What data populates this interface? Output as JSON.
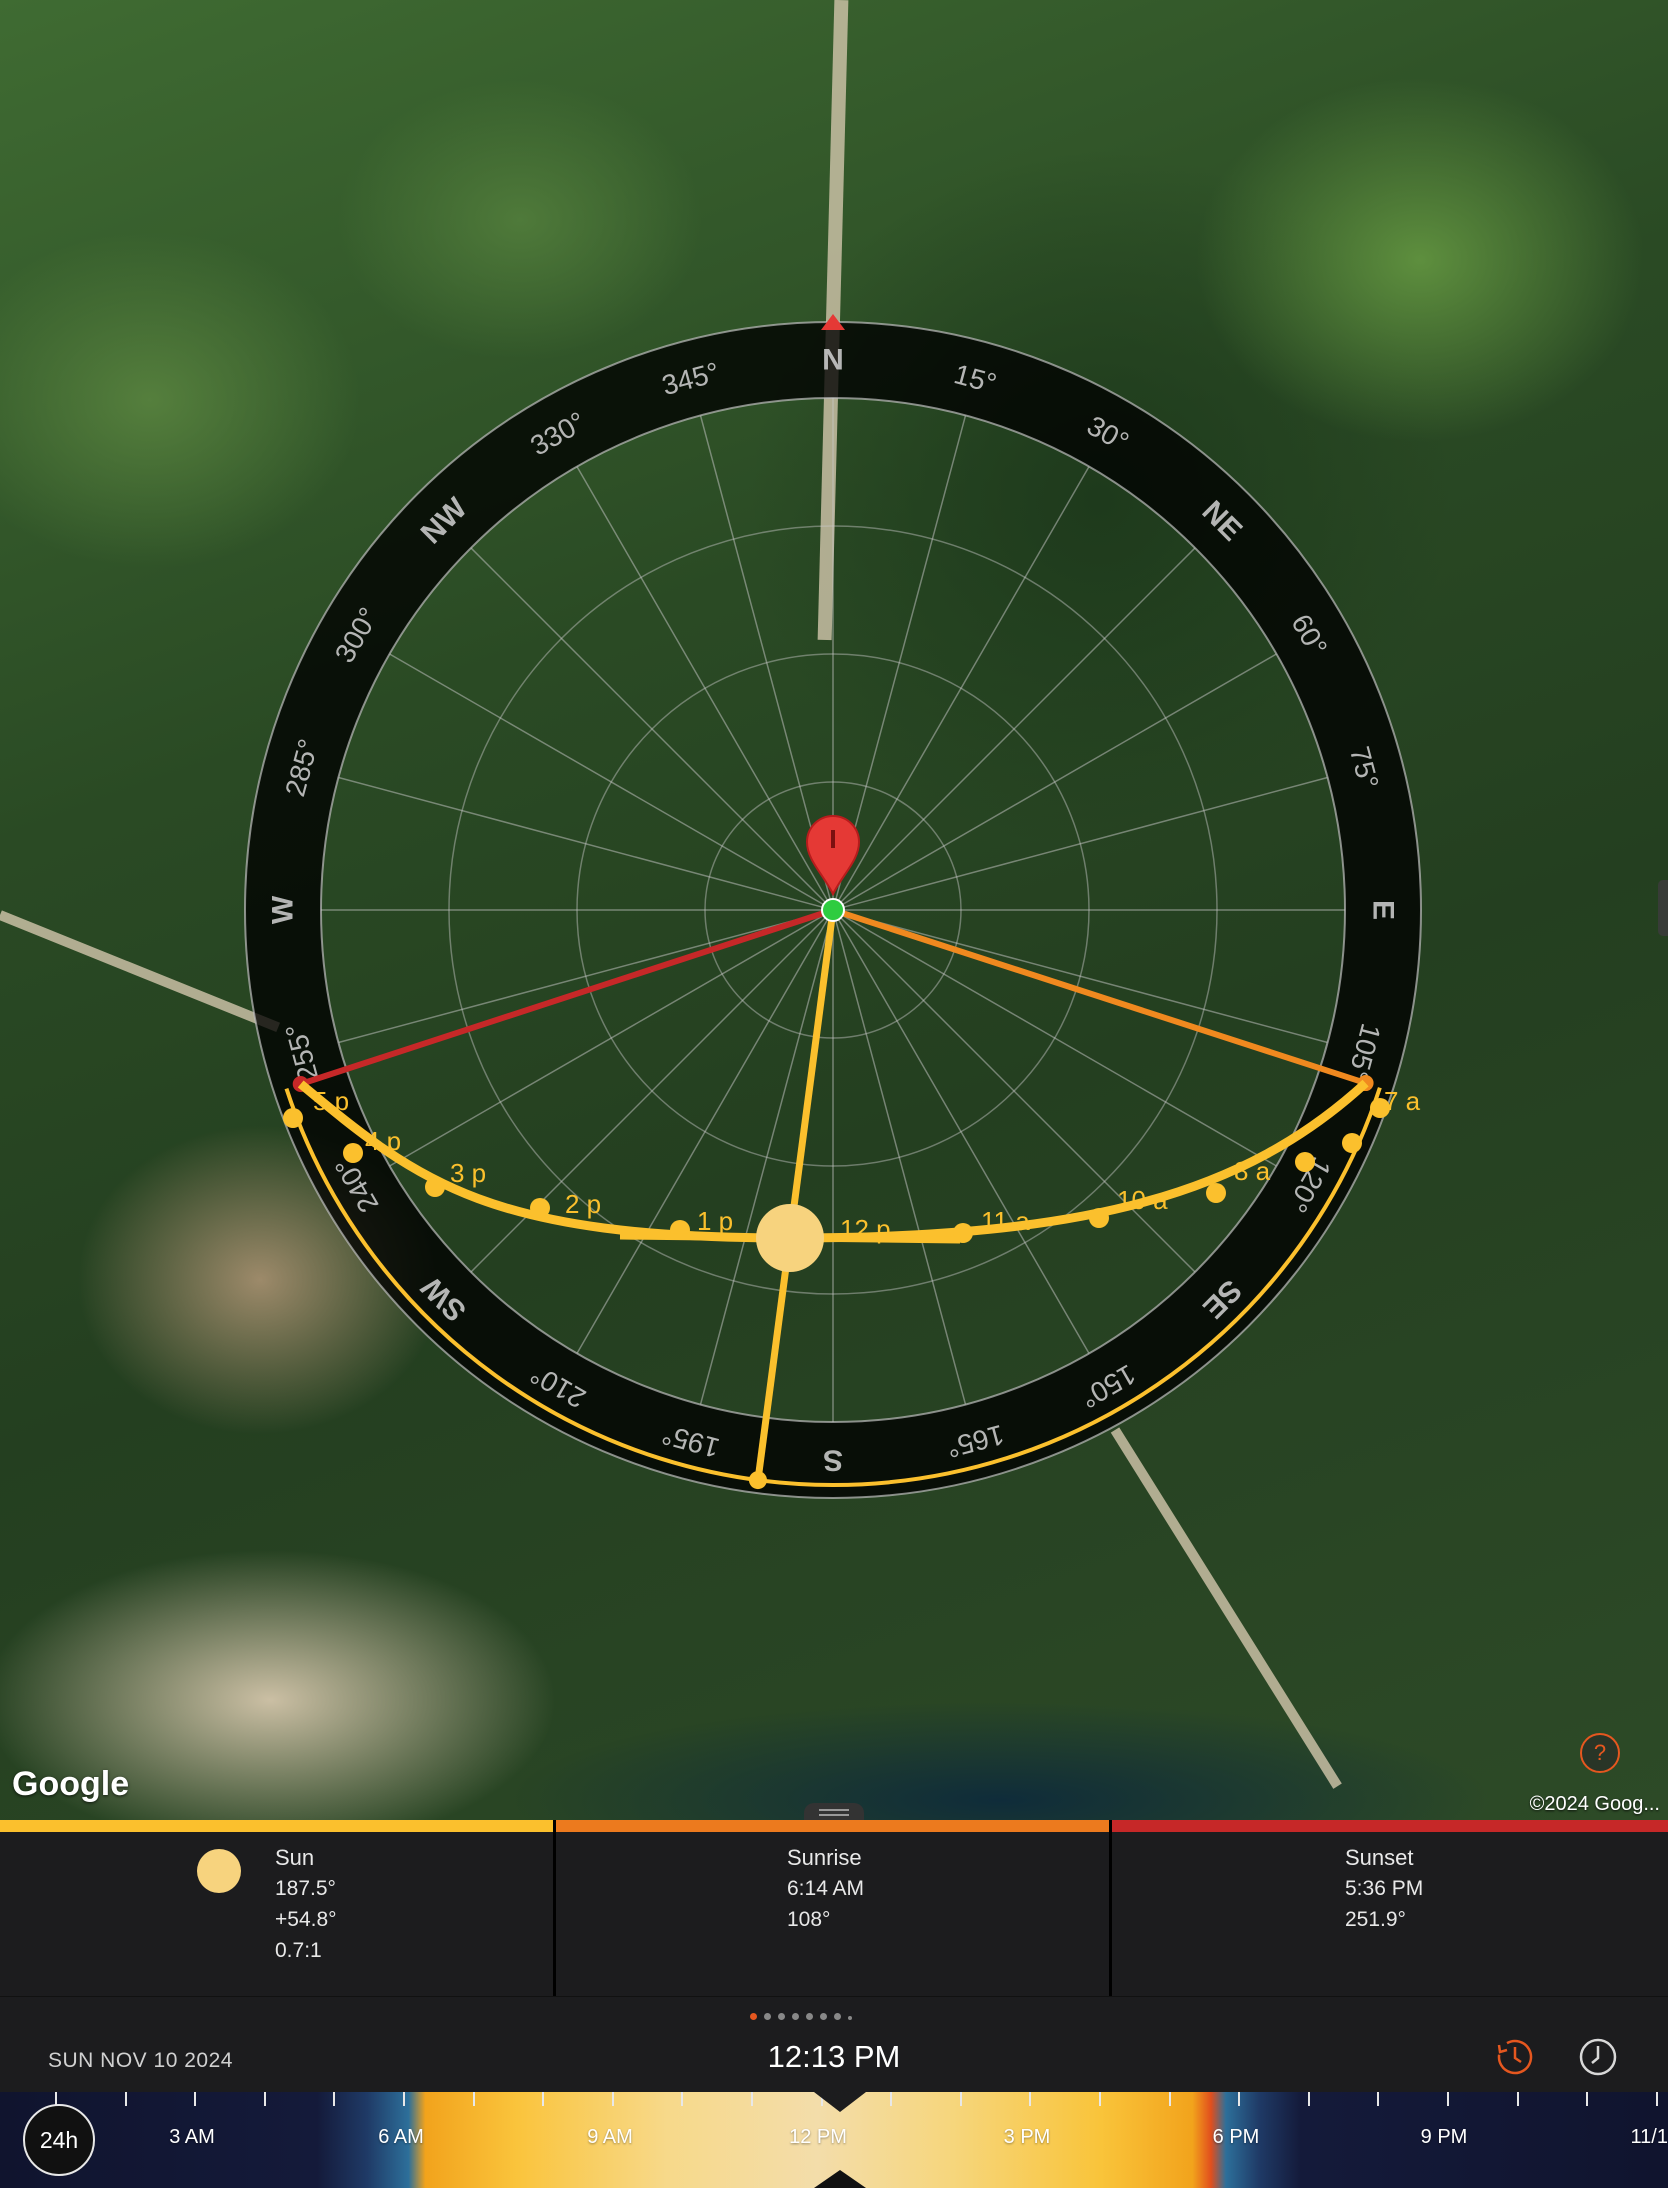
{
  "map": {
    "attribution_logo": "Google",
    "copyright": "©2024 Goog...",
    "help_label": "?"
  },
  "compass": {
    "cardinals": [
      {
        "label": "N",
        "az": 0
      },
      {
        "label": "E",
        "az": 90
      },
      {
        "label": "S",
        "az": 180
      },
      {
        "label": "W",
        "az": 270
      }
    ],
    "intercardinals": [
      {
        "label": "NE",
        "az": 45
      },
      {
        "label": "SE",
        "az": 135
      },
      {
        "label": "SW",
        "az": 225
      },
      {
        "label": "NW",
        "az": 315
      }
    ],
    "degree_labels": [
      {
        "label": "15°",
        "az": 15
      },
      {
        "label": "30°",
        "az": 30
      },
      {
        "label": "60°",
        "az": 60
      },
      {
        "label": "75°",
        "az": 75
      },
      {
        "label": "105°",
        "az": 105
      },
      {
        "label": "120°",
        "az": 120
      },
      {
        "label": "150°",
        "az": 150
      },
      {
        "label": "165°",
        "az": 165
      },
      {
        "label": "195°",
        "az": 195
      },
      {
        "label": "210°",
        "az": 210
      },
      {
        "label": "240°",
        "az": 240
      },
      {
        "label": "255°",
        "az": 255
      },
      {
        "label": "285°",
        "az": 285
      },
      {
        "label": "300°",
        "az": 300
      },
      {
        "label": "330°",
        "az": 330
      },
      {
        "label": "345°",
        "az": 345
      }
    ],
    "sunrise_azimuth": 108,
    "sunset_azimuth": 251.9,
    "sun_azimuth": 187.5,
    "sun_elevation": 54.8,
    "sun_path_labels": [
      {
        "label": "7 a"
      },
      {
        "label": "8 a"
      },
      {
        "label": "10 a"
      },
      {
        "label": "11 a"
      },
      {
        "label": "12 p"
      },
      {
        "label": "1 p"
      },
      {
        "label": "2 p"
      },
      {
        "label": "3 p"
      },
      {
        "label": "4 p"
      },
      {
        "label": "5 p"
      }
    ],
    "colors": {
      "sun": "#fbc02d",
      "sunrise": "#f0891f",
      "sunset": "#c62828",
      "marker": "#e53935",
      "location": "#2ecc40"
    }
  },
  "panels": [
    {
      "title": "Sun",
      "lines": [
        "187.5°",
        "+54.8°",
        "0.7:1"
      ],
      "icon": "sun-icon"
    },
    {
      "title": "Sunrise",
      "lines": [
        "6:14 AM",
        "108°"
      ]
    },
    {
      "title": "Sunset",
      "lines": [
        "5:36 PM",
        "251.9°"
      ]
    }
  ],
  "status": {
    "date": "SUN NOV 10 2024",
    "time": "12:13 PM",
    "page_count": 8,
    "current_page": 1
  },
  "timeline": {
    "toggle_label": "24h",
    "labels": [
      "3 AM",
      "6 AM",
      "9 AM",
      "12 PM",
      "3 PM",
      "6 PM",
      "9 PM",
      "11/1"
    ],
    "current_time_fraction": 0.509
  }
}
